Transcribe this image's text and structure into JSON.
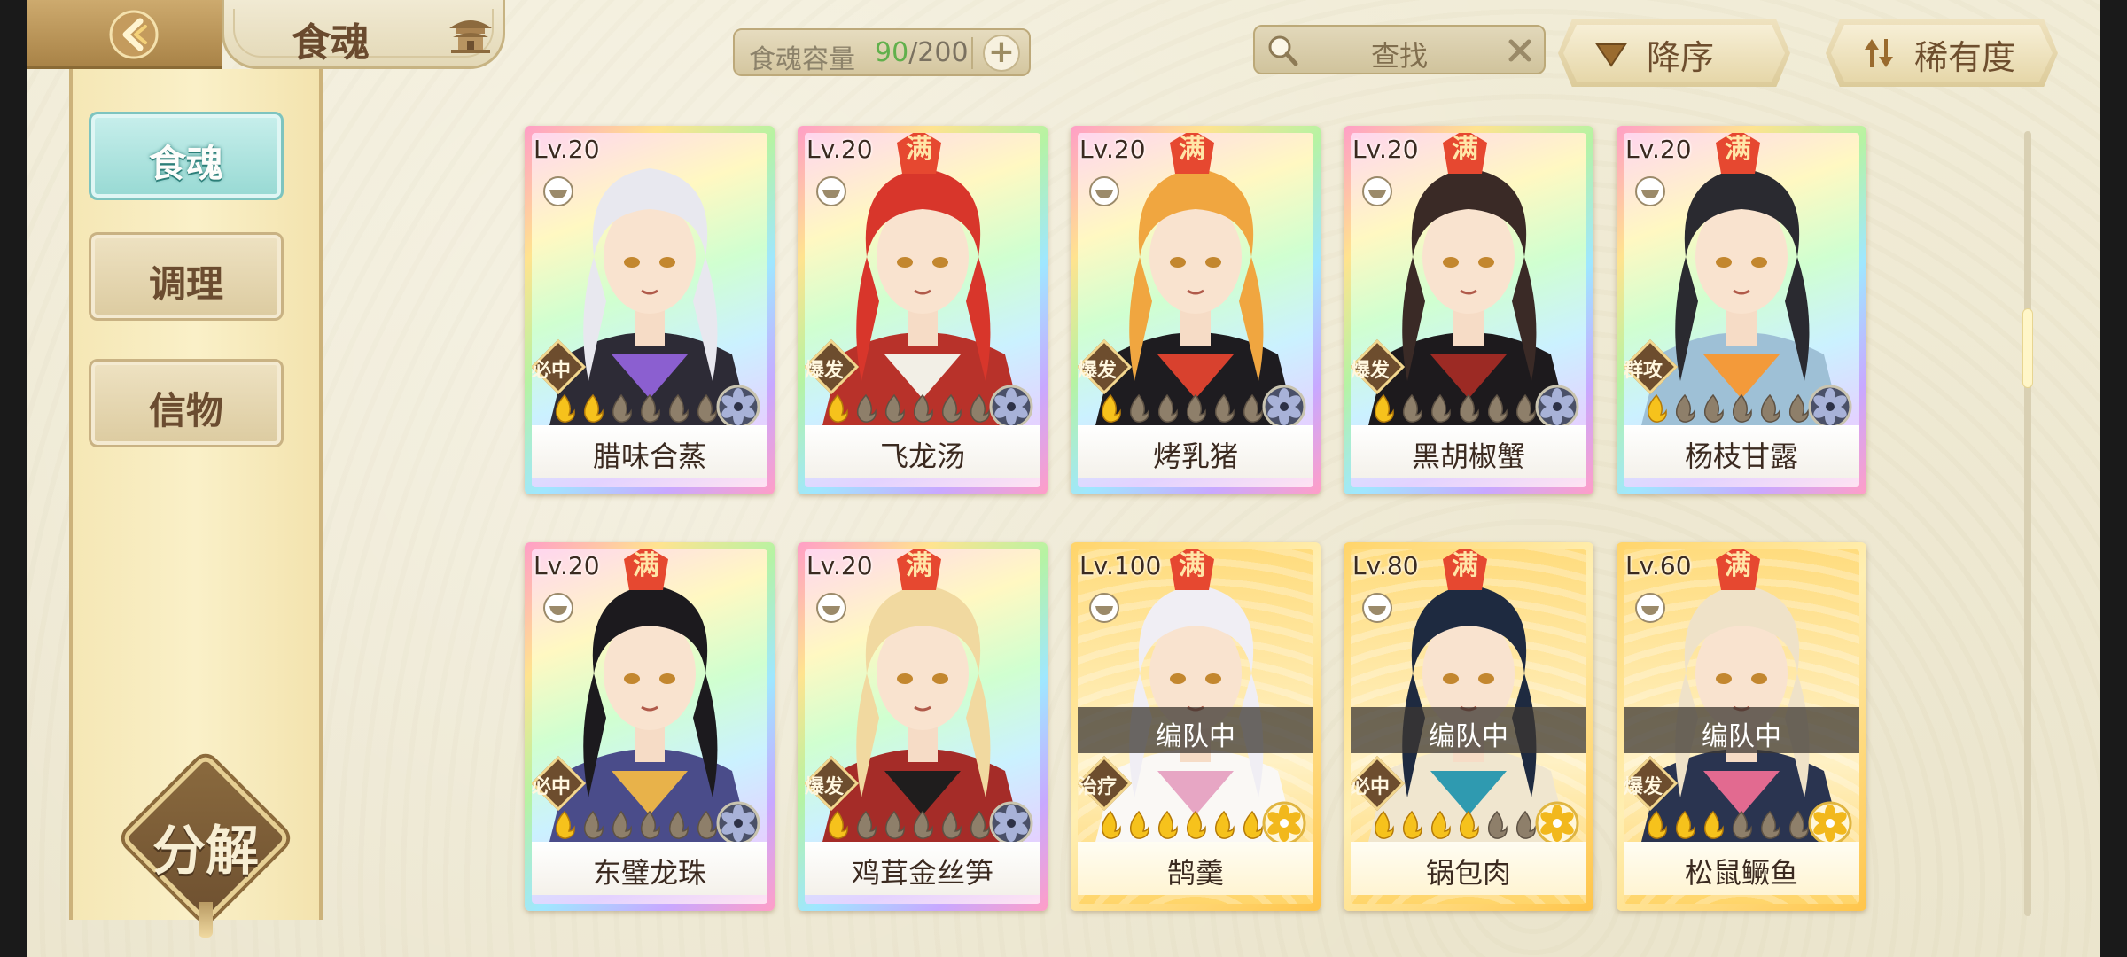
{
  "header": {
    "title": "食魂",
    "capacity_label": "食魂容量",
    "capacity_current": "90",
    "capacity_sep": "/",
    "capacity_max": "200",
    "capacity_add": "+",
    "search_placeholder": "查找",
    "sort_order": "降序",
    "sort_by": "稀有度"
  },
  "sidebar": {
    "tabs": [
      {
        "label": "食魂",
        "active": true
      },
      {
        "label": "调理",
        "active": false
      },
      {
        "label": "信物",
        "active": false
      }
    ],
    "decompose": "分解"
  },
  "cards": [
    {
      "name": "腊味合蒸",
      "level": "Lv.20",
      "max": "",
      "role": "必中",
      "stars": 2,
      "frame": "rainbow",
      "element": "night",
      "team": "",
      "hair": "#e8e8ef",
      "outfit": "#2d2b36",
      "accent": "#8b5fd0"
    },
    {
      "name": "飞龙汤",
      "level": "Lv.20",
      "max": "满",
      "role": "爆发",
      "stars": 1,
      "frame": "rainbow",
      "element": "night",
      "team": "",
      "hair": "#d8362b",
      "outfit": "#b8322a",
      "accent": "#f2efe6"
    },
    {
      "name": "烤乳猪",
      "level": "Lv.20",
      "max": "满",
      "role": "爆发",
      "stars": 1,
      "frame": "rainbow",
      "element": "night",
      "team": "",
      "hair": "#f0a640",
      "outfit": "#1e1c20",
      "accent": "#d8412e"
    },
    {
      "name": "黑胡椒蟹",
      "level": "Lv.20",
      "max": "满",
      "role": "爆发",
      "stars": 1,
      "frame": "rainbow",
      "element": "night",
      "team": "",
      "hair": "#3a2a26",
      "outfit": "#1d1a1d",
      "accent": "#9c2a24"
    },
    {
      "name": "杨枝甘露",
      "level": "Lv.20",
      "max": "满",
      "role": "群攻",
      "stars": 1,
      "frame": "rainbow",
      "element": "night",
      "team": "",
      "hair": "#2a2a30",
      "outfit": "#9ec0d6",
      "accent": "#f39a3a"
    },
    {
      "name": "东璧龙珠",
      "level": "Lv.20",
      "max": "满",
      "role": "必中",
      "stars": 1,
      "frame": "rainbow",
      "element": "night",
      "team": "",
      "hair": "#1c1a1e",
      "outfit": "#4a4c8a",
      "accent": "#e8b24a"
    },
    {
      "name": "鸡茸金丝笋",
      "level": "Lv.20",
      "max": "满",
      "role": "爆发",
      "stars": 1,
      "frame": "rainbow",
      "element": "night",
      "team": "",
      "hair": "#f1d9a0",
      "outfit": "#a52c28",
      "accent": "#1f1d1d"
    },
    {
      "name": "鹄羹",
      "level": "Lv.100",
      "max": "满",
      "role": "治疗",
      "stars": 6,
      "frame": "gold",
      "element": "day",
      "team": "编队中",
      "hair": "#f0eef4",
      "outfit": "#faf8f5",
      "accent": "#e7a6c4"
    },
    {
      "name": "锅包肉",
      "level": "Lv.80",
      "max": "满",
      "role": "必中",
      "stars": 4,
      "frame": "gold",
      "element": "day",
      "team": "编队中",
      "hair": "#1e2a40",
      "outfit": "#f0e6cf",
      "accent": "#2f9ab0"
    },
    {
      "name": "松鼠鳜鱼",
      "level": "Lv.60",
      "max": "满",
      "role": "爆发",
      "stars": 3,
      "frame": "gold",
      "element": "day",
      "team": "编队中",
      "hair": "#efe2c8",
      "outfit": "#2a3450",
      "accent": "#e26a90"
    }
  ],
  "colors": {
    "accent_teal": "#97d9d3",
    "gold_frame": "#ffd46a",
    "capacity_green": "#61b04c",
    "max_badge": "#e64830",
    "star_filled": "#f6c21c",
    "star_empty": "#8e7f6a"
  },
  "icons": {
    "back": "back-arrow-icon",
    "home": "pavilion-icon",
    "search": "search-icon",
    "clear": "close-icon",
    "sort_order": "triangle-down-icon",
    "sort_by": "sort-arrows-icon",
    "food_type": "bowl-icon",
    "element_night": "dark-flower-icon",
    "element_day": "gold-flower-icon",
    "star": "flame-star-icon"
  }
}
